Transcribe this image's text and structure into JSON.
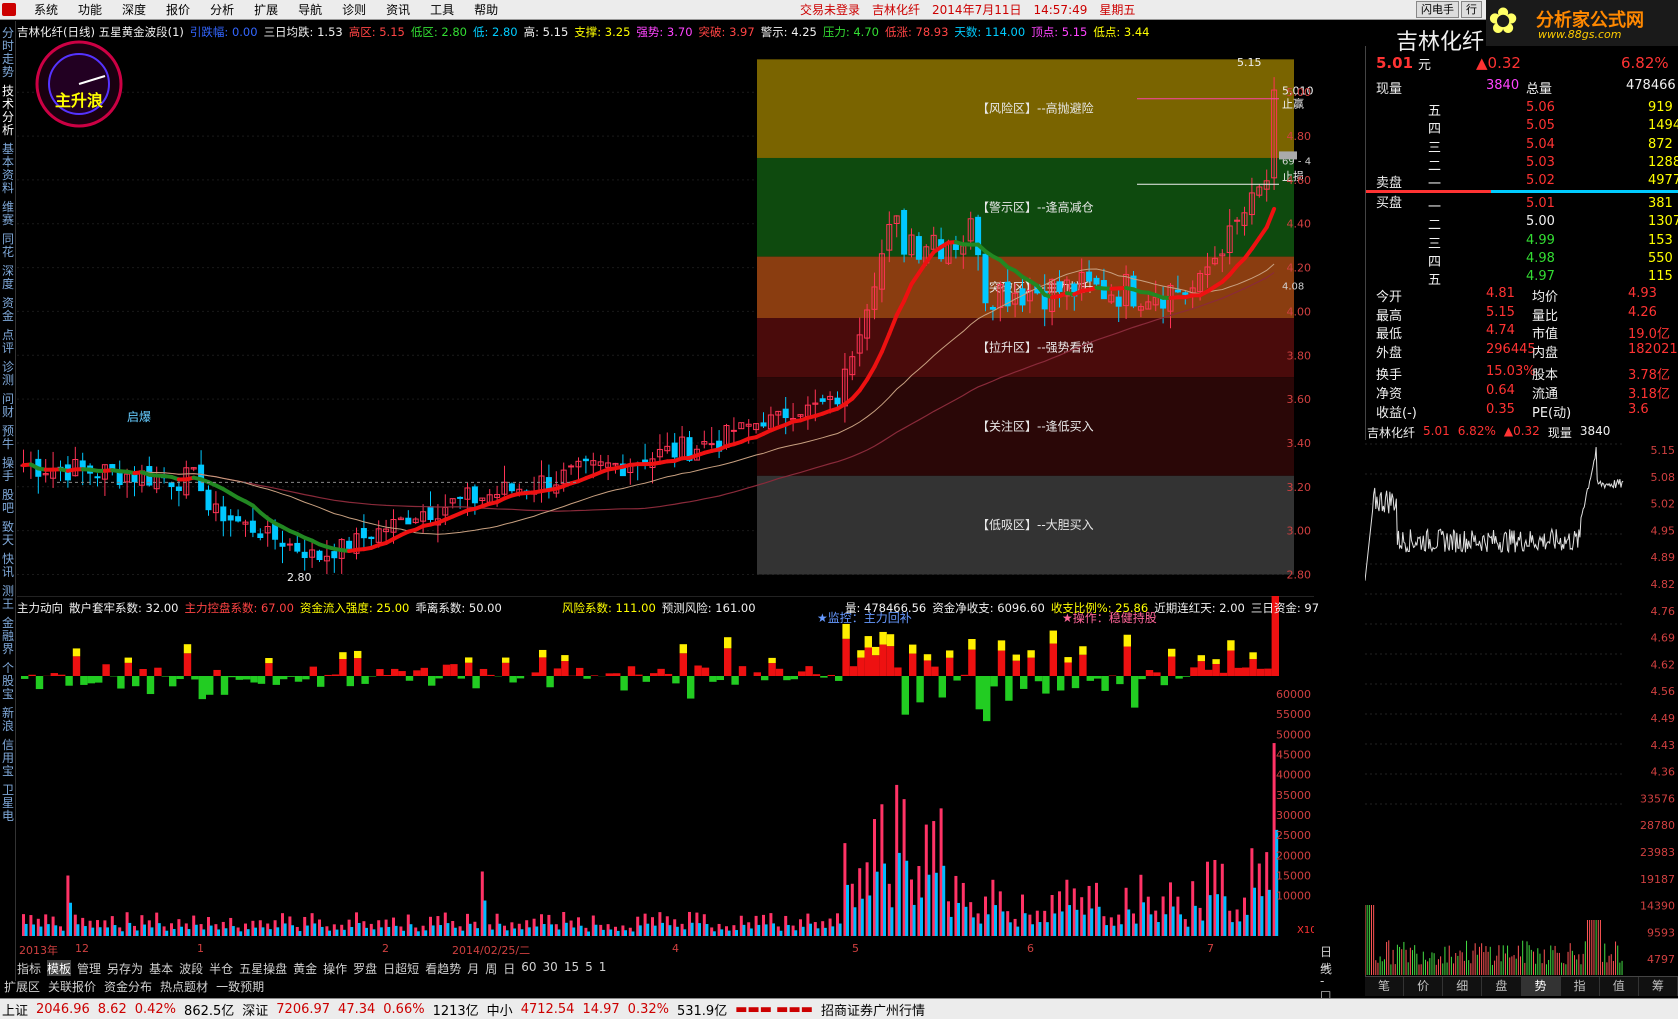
{
  "menubar": {
    "items": [
      "系统",
      "功能",
      "深度",
      "报价",
      "分析",
      "扩展",
      "导航",
      "诊则",
      "资讯",
      "工具",
      "帮助"
    ],
    "center": [
      "交易未登录",
      "吉林化纤",
      "2014年7月11日",
      "14:57:49",
      "星期五"
    ],
    "right": [
      "闪电手",
      "行"
    ]
  },
  "brand": {
    "name": "分析家公式网",
    "url": "www.88gs.com",
    "flower": "✿"
  },
  "sidetabs": [
    "分时走势",
    "技术分析",
    "基本资料",
    "维赛",
    "同花",
    "深度",
    "资金",
    "点评",
    "诊测",
    "问财",
    "预牛",
    "操手",
    "股吧",
    "致天",
    "快讯",
    "测王",
    "金融界",
    "个股宝",
    "新浪",
    "信用宝",
    "卫星电"
  ],
  "sidetabs_active": 1,
  "gauge_label": "主升浪",
  "chart": {
    "title": "吉林化纤(日线) 五星黄金波段(1)",
    "info": [
      {
        "t": "引跌幅: 0.00",
        "c": "#3366ff"
      },
      {
        "t": "三日均跌: 1.53",
        "c": "#f0f0f0"
      },
      {
        "t": "高区: 5.15",
        "c": "#ff4444"
      },
      {
        "t": "低区: 2.80",
        "c": "#33dd33"
      },
      {
        "t": "低: 2.80",
        "c": "#00ccff"
      },
      {
        "t": "高: 5.15",
        "c": "#f0f0f0"
      },
      {
        "t": "支撑: 3.25",
        "c": "#ffff00"
      },
      {
        "t": "强势: 3.70",
        "c": "#ff44ff"
      },
      {
        "t": "突破: 3.97",
        "c": "#ff4444"
      },
      {
        "t": "警示: 4.25",
        "c": "#f0f0f0"
      },
      {
        "t": "压力: 4.70",
        "c": "#33dd33"
      },
      {
        "t": "低涨: 78.93",
        "c": "#ff4444"
      },
      {
        "t": "天数: 114.00",
        "c": "#00ccff"
      },
      {
        "t": "顶点: 5.15",
        "c": "#ff44ff"
      },
      {
        "t": "低点: 3.44",
        "c": "#ffff00"
      }
    ],
    "zones": [
      {
        "label": "【风险区】--高抛避险",
        "color": "#7a6400",
        "lo": 4.7,
        "hi": 5.15
      },
      {
        "label": "【警示区】--逢高减仓",
        "color": "#0e4a0e",
        "lo": 4.25,
        "hi": 4.7
      },
      {
        "label": "【突破区】--主力拉升",
        "color": "#8a3d10",
        "lo": 3.97,
        "hi": 4.25
      },
      {
        "label": "【拉升区】--强势看锐",
        "color": "#4a0b0b",
        "lo": 3.7,
        "hi": 3.97
      },
      {
        "label": "【关注区】--逢低买入",
        "color": "#2a0707",
        "lo": 3.25,
        "hi": 3.7
      },
      {
        "label": "【低吸区】--大胆买入",
        "color": "#333333",
        "lo": 2.8,
        "hi": 3.25
      }
    ],
    "annotations": {
      "qibao": "启爆",
      "low_mark": "2.80",
      "high_mark": "5.15",
      "stop_profit": "止赢",
      "stop_loss": "止损",
      "price_tag": "5.010",
      "mid_val": "4.08",
      "top_val": "69 - 4"
    },
    "ylabels": [
      "5.00",
      "4.80",
      "4.60",
      "4.40",
      "4.20",
      "4.00",
      "3.80",
      "3.60",
      "3.40",
      "3.20",
      "3.00",
      "2.80"
    ],
    "xlabels": [
      "2013年",
      "12",
      "1",
      "2",
      "2014/02/25/二",
      "4",
      "5",
      "6",
      "7"
    ]
  },
  "indicator": {
    "info1": [
      {
        "t": "主力动向",
        "c": "#f0f0f0"
      },
      {
        "t": "散户套牢系数: 32.00",
        "c": "#f0f0f0"
      },
      {
        "t": "主力控盘系数: 67.00",
        "c": "#ff4444"
      },
      {
        "t": "资金流入强度: 25.00",
        "c": "#ffff00"
      },
      {
        "t": "乖离系数: 50.00",
        "c": "#f0f0f0"
      }
    ],
    "info2": [
      {
        "t": "风险系数: 111.00",
        "c": "#ffff00"
      },
      {
        "t": "预测风险: 161.00",
        "c": "#f0f0f0"
      }
    ],
    "info3": [
      {
        "t": "量: 478466.56",
        "c": "#f0f0f0"
      },
      {
        "t": "资金净收支: 6096.60",
        "c": "#f0f0f0"
      },
      {
        "t": "收支比例%: 25.86",
        "c": "#ffff00"
      },
      {
        "t": "近期连红天: 2.00",
        "c": "#f0f0f0"
      },
      {
        "t": "三日资金: 97",
        "c": "#f0f0f0"
      }
    ],
    "monitor": "★监控：主力回补",
    "operation": "★操作：稳健持股",
    "vol_labels": [
      "60000",
      "55000",
      "50000",
      "45000",
      "40000",
      "35000",
      "30000",
      "25000",
      "20000",
      "15000",
      "10000"
    ],
    "x10": "X10"
  },
  "bottomnav": {
    "items": [
      "指标",
      "模板",
      "管理",
      "另存为",
      "基本",
      "波段",
      "半仓",
      "五星操盘",
      "黄金",
      "操作",
      "罗盘",
      "日超短",
      "看趋势",
      "月",
      "周",
      "日",
      "60",
      "30",
      "15",
      "5",
      "1"
    ],
    "selected": 1,
    "right": "日线",
    "pm": "+ - □"
  },
  "bottomnav2": [
    "扩展区",
    "关联报价",
    "资金分布",
    "热点题材",
    "一致预期"
  ],
  "statusbar": [
    {
      "t": "上证",
      "c": "#000"
    },
    {
      "t": "2046.96",
      "c": "#c00"
    },
    {
      "t": "8.62",
      "c": "#c00"
    },
    {
      "t": "0.42%",
      "c": "#c00"
    },
    {
      "t": "862.5亿",
      "c": "#000"
    },
    {
      "t": "深证",
      "c": "#000"
    },
    {
      "t": "7206.97",
      "c": "#c00"
    },
    {
      "t": "47.34",
      "c": "#c00"
    },
    {
      "t": "0.66%",
      "c": "#c00"
    },
    {
      "t": "1213亿",
      "c": "#000"
    },
    {
      "t": "中小",
      "c": "#000"
    },
    {
      "t": "4712.54",
      "c": "#c00"
    },
    {
      "t": "14.97",
      "c": "#c00"
    },
    {
      "t": "0.32%",
      "c": "#c00"
    },
    {
      "t": "531.9亿",
      "c": "#000"
    },
    {
      "t": "▬▬▬ ▬▬▬",
      "c": "#c00"
    },
    {
      "t": "招商证券广州行情",
      "c": "#000"
    }
  ],
  "quote": {
    "name": "吉林化纤",
    "price": "5.01",
    "unit": "元",
    "change": "▲0.32",
    "pct": "6.82%",
    "now_vol_label": "现量",
    "now_vol": "3840",
    "total_label": "总量",
    "total": "478466",
    "asks": [
      [
        "五",
        "5.06",
        "919"
      ],
      [
        "四",
        "5.05",
        "1494"
      ],
      [
        "三",
        "5.04",
        "872"
      ],
      [
        "二",
        "5.03",
        "1288"
      ],
      [
        "一",
        "5.02",
        "4977"
      ]
    ],
    "bids": [
      [
        "一",
        "5.01",
        "381"
      ],
      [
        "二",
        "5.00",
        "1307"
      ],
      [
        "三",
        "4.99",
        "153"
      ],
      [
        "四",
        "4.98",
        "550"
      ],
      [
        "五",
        "4.97",
        "115"
      ]
    ],
    "sell_label": "卖盘",
    "buy_label": "买盘",
    "stats": [
      [
        "今开",
        "4.81",
        "均价",
        "4.93"
      ],
      [
        "最高",
        "5.15",
        "量比",
        "4.26"
      ],
      [
        "最低",
        "4.74",
        "市值",
        "19.0亿"
      ],
      [
        "外盘",
        "296445",
        "内盘",
        "182021"
      ],
      [
        "换手",
        "15.03%",
        "股本",
        "3.78亿"
      ],
      [
        "净资",
        "0.64",
        "流通",
        "3.18亿"
      ],
      [
        "收益(-)",
        "0.35",
        "PE(动)",
        "3.6"
      ]
    ],
    "mini": {
      "name": "吉林化纤",
      "price": "5.01",
      "pct": "6.82%",
      "chg": "▲0.32",
      "vol_label": "现量",
      "vol": "3840",
      "rlabels": [
        "5.15",
        "5.08",
        "5.02",
        "4.95",
        "4.89",
        "4.82",
        "4.76",
        "4.69",
        "4.62",
        "4.56",
        "4.49",
        "4.43",
        "4.36",
        "33576",
        "28780",
        "23983",
        "19187",
        "14390",
        "9593",
        "4797"
      ]
    },
    "tabs": [
      "笔",
      "价",
      "细",
      "盘",
      "势",
      "指",
      "值",
      "筹"
    ],
    "tab_active": 4
  }
}
